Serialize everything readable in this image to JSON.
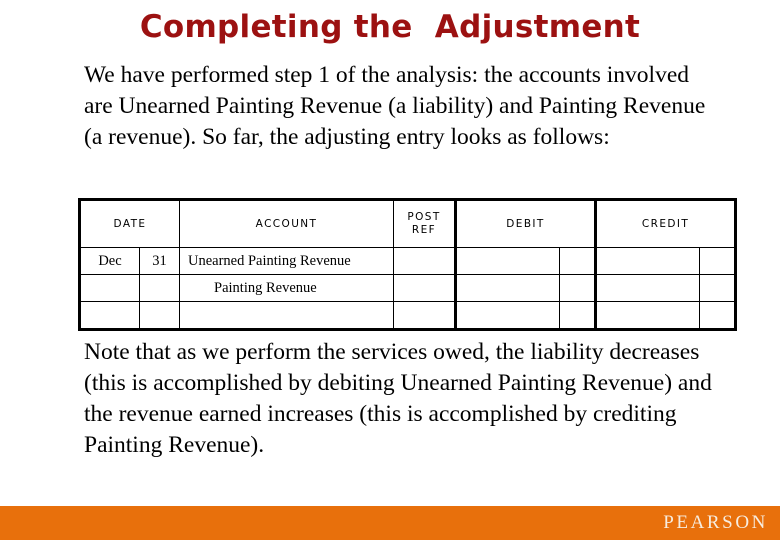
{
  "slide": {
    "title": "Completing the  Adjustment",
    "title_color": "#9c1111",
    "background_color": "#ffffff"
  },
  "intro_text": "We have performed step 1 of the analysis:  the accounts involved are Unearned Painting Revenue (a liability) and Painting Revenue (a revenue).  So far, the adjusting entry looks as follows:",
  "journal": {
    "headers": {
      "date": "DATE",
      "account": "ACCOUNT",
      "post_ref_line1": "POST",
      "post_ref_line2": "REF",
      "debit": "DEBIT",
      "credit": "CREDIT"
    },
    "rows": [
      {
        "month": "Dec",
        "day": "31",
        "account": "Unearned Painting Revenue",
        "indent": false,
        "post_ref": "",
        "debit": "",
        "debit_cents": "",
        "credit": "",
        "credit_cents": ""
      },
      {
        "month": "",
        "day": "",
        "account": "Painting Revenue",
        "indent": true,
        "post_ref": "",
        "debit": "",
        "debit_cents": "",
        "credit": "",
        "credit_cents": ""
      },
      {
        "month": "",
        "day": "",
        "account": "",
        "indent": false,
        "post_ref": "",
        "debit": "",
        "debit_cents": "",
        "credit": "",
        "credit_cents": ""
      }
    ]
  },
  "closing_text": "Note that as we perform the services owed, the liability decreases (this is accomplished by debiting Unearned Painting Revenue) and the revenue earned increases (this is accomplished by crediting Painting Revenue).",
  "footer": {
    "brand": "PEARSON",
    "bar_color": "#e8700c",
    "brand_color": "#f7ecdf"
  }
}
